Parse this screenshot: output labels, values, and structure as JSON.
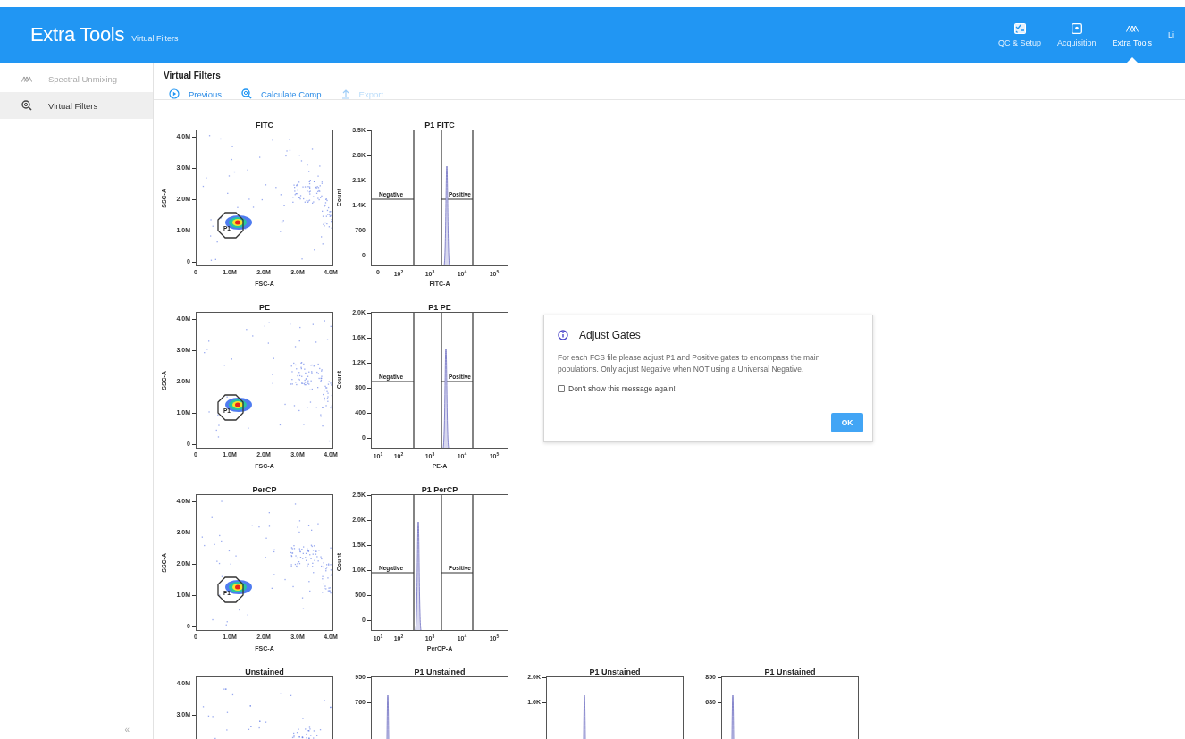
{
  "app": {
    "title": "Extra Tools",
    "subtitle": "Virtual Filters"
  },
  "nav": [
    {
      "label": "QC & Setup",
      "selected": false
    },
    {
      "label": "Acquisition",
      "selected": false
    },
    {
      "label": "Extra Tools",
      "selected": true
    },
    {
      "label": "Li",
      "selected": false
    }
  ],
  "sidebar": {
    "items": [
      {
        "label": "Spectral Unmixing",
        "selected": false
      },
      {
        "label": "Virtual Filters",
        "selected": true
      }
    ],
    "collapse": "«"
  },
  "page": {
    "title": "Virtual Filters",
    "toolbar": [
      {
        "label": "Previous",
        "disabled": false
      },
      {
        "label": "Calculate Comp",
        "disabled": false
      },
      {
        "label": "Export",
        "disabled": true
      }
    ]
  },
  "plots": [
    {
      "cells": [
        {
          "kind": "scatter",
          "title": "FITC",
          "ylabel": "SSC-A",
          "xlabel": "FSC-A",
          "yticks": [
            "4.0M",
            "3.0M",
            "2.0M",
            "1.0M",
            "0"
          ],
          "xticks": [
            "0",
            "1.0M",
            "2.0M",
            "3.0M",
            "4.0M"
          ],
          "gate": "P1"
        },
        {
          "kind": "histogram",
          "title": "P1 FITC",
          "ylabel": "Count",
          "xlabel": "FITC-A",
          "yticks": [
            "3.5K",
            "2.8K",
            "2.1K",
            "1.4K",
            "700",
            "0"
          ],
          "xticks": [
            "0",
            "10$^{2}$",
            "10$^{3}$",
            "10$^{4}$",
            "10$^{5}$"
          ],
          "gates": [
            {
              "label": "Negative"
            },
            {
              "label": "Positive"
            }
          ]
        }
      ]
    },
    {
      "cells": [
        {
          "kind": "scatter",
          "title": "PE",
          "ylabel": "SSC-A",
          "xlabel": "FSC-A",
          "yticks": [
            "4.0M",
            "3.0M",
            "2.0M",
            "1.0M",
            "0"
          ],
          "xticks": [
            "0",
            "1.0M",
            "2.0M",
            "3.0M",
            "4.0M"
          ],
          "gate": "P1"
        },
        {
          "kind": "histogram",
          "title": "P1 PE",
          "ylabel": "Count",
          "xlabel": "PE-A",
          "yticks": [
            "2.0K",
            "1.6K",
            "1.2K",
            "800",
            "400",
            "0"
          ],
          "xticks": [
            "10$^{1}$",
            "10$^{2}$",
            "10$^{3}$",
            "10$^{4}$",
            "10$^{5}$"
          ],
          "gates": [
            {
              "label": "Negative"
            },
            {
              "label": "Positive"
            }
          ]
        }
      ]
    },
    {
      "cells": [
        {
          "kind": "scatter",
          "title": "PerCP",
          "ylabel": "SSC-A",
          "xlabel": "FSC-A",
          "yticks": [
            "4.0M",
            "3.0M",
            "2.0M",
            "1.0M",
            "0"
          ],
          "xticks": [
            "0",
            "1.0M",
            "2.0M",
            "3.0M",
            "4.0M"
          ],
          "gate": "P1"
        },
        {
          "kind": "histogram",
          "title": "P1 PerCP",
          "ylabel": "Count",
          "xlabel": "PerCP-A",
          "yticks": [
            "2.5K",
            "2.0K",
            "1.5K",
            "1.0K",
            "500",
            "0"
          ],
          "xticks": [
            "10$^{1}$",
            "10$^{2}$",
            "10$^{3}$",
            "10$^{4}$",
            "10$^{5}$"
          ],
          "gates": [
            {
              "label": "Negative"
            },
            {
              "label": "Positive"
            }
          ]
        }
      ]
    },
    {
      "cells": [
        {
          "kind": "scatter",
          "title": "Unstained",
          "yticks": [
            "4.0M",
            "3.0M"
          ]
        },
        {
          "kind": "histogram",
          "title": "P1 Unstained",
          "yticks": [
            "950",
            "760"
          ]
        },
        {
          "kind": "histogram",
          "title": "P1 Unstained",
          "yticks": [
            "2.0K",
            "1.6K"
          ]
        },
        {
          "kind": "histogram",
          "title": "P1 Unstained",
          "yticks": [
            "850",
            "680"
          ]
        }
      ]
    }
  ],
  "dialog": {
    "title": "Adjust Gates",
    "message": "For each FCS file please adjust P1 and Positive gates to encompass the main populations. Only adjust Negative when NOT using a Universal Negative.",
    "checkbox": {
      "label": "Don't show this message again!",
      "checked": false
    },
    "button": "OK"
  }
}
